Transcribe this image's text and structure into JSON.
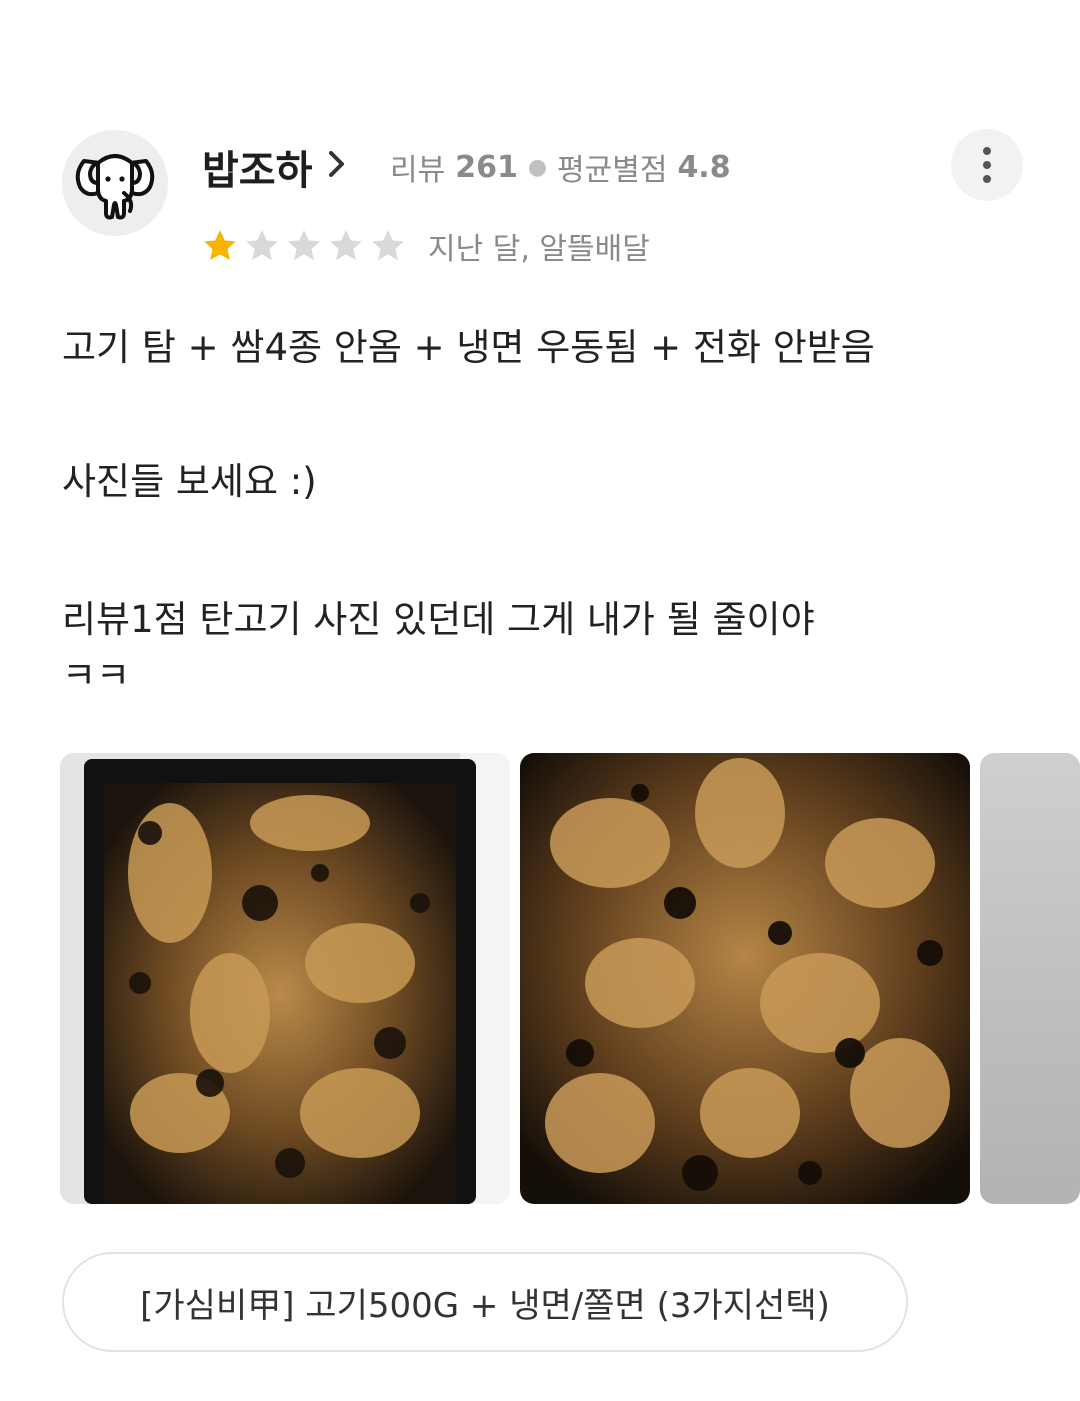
{
  "reviewer": {
    "name": "밥조하",
    "review_count_label": "리뷰",
    "review_count": "261",
    "avg_rating_label": "평균별점",
    "avg_rating": "4.8"
  },
  "rating": {
    "stars_filled": 1,
    "stars_total": 5
  },
  "meta": "지난 달, 알뜰배달",
  "review": {
    "line1": "고기 탐 + 쌈4종 안옴 + 냉면 우동됨 + 전화 안받음",
    "line2": "사진들 보세요 :)",
    "line3": "리뷰1점 탄고기 사진 있던데 그게 내가 될 줄이야",
    "line4": "ㅋㅋ"
  },
  "menu_item": "[가심비甲] 고기500G + 냉면/쫄면 (3가지선택)",
  "icons": {
    "avatar": "elephant-icon",
    "more": "more-vertical-icon",
    "chevron": "chevron-right-icon"
  },
  "colors": {
    "star_filled": "#f7b500",
    "star_empty": "#d9d9d9",
    "muted_text": "#8a8a8a"
  }
}
